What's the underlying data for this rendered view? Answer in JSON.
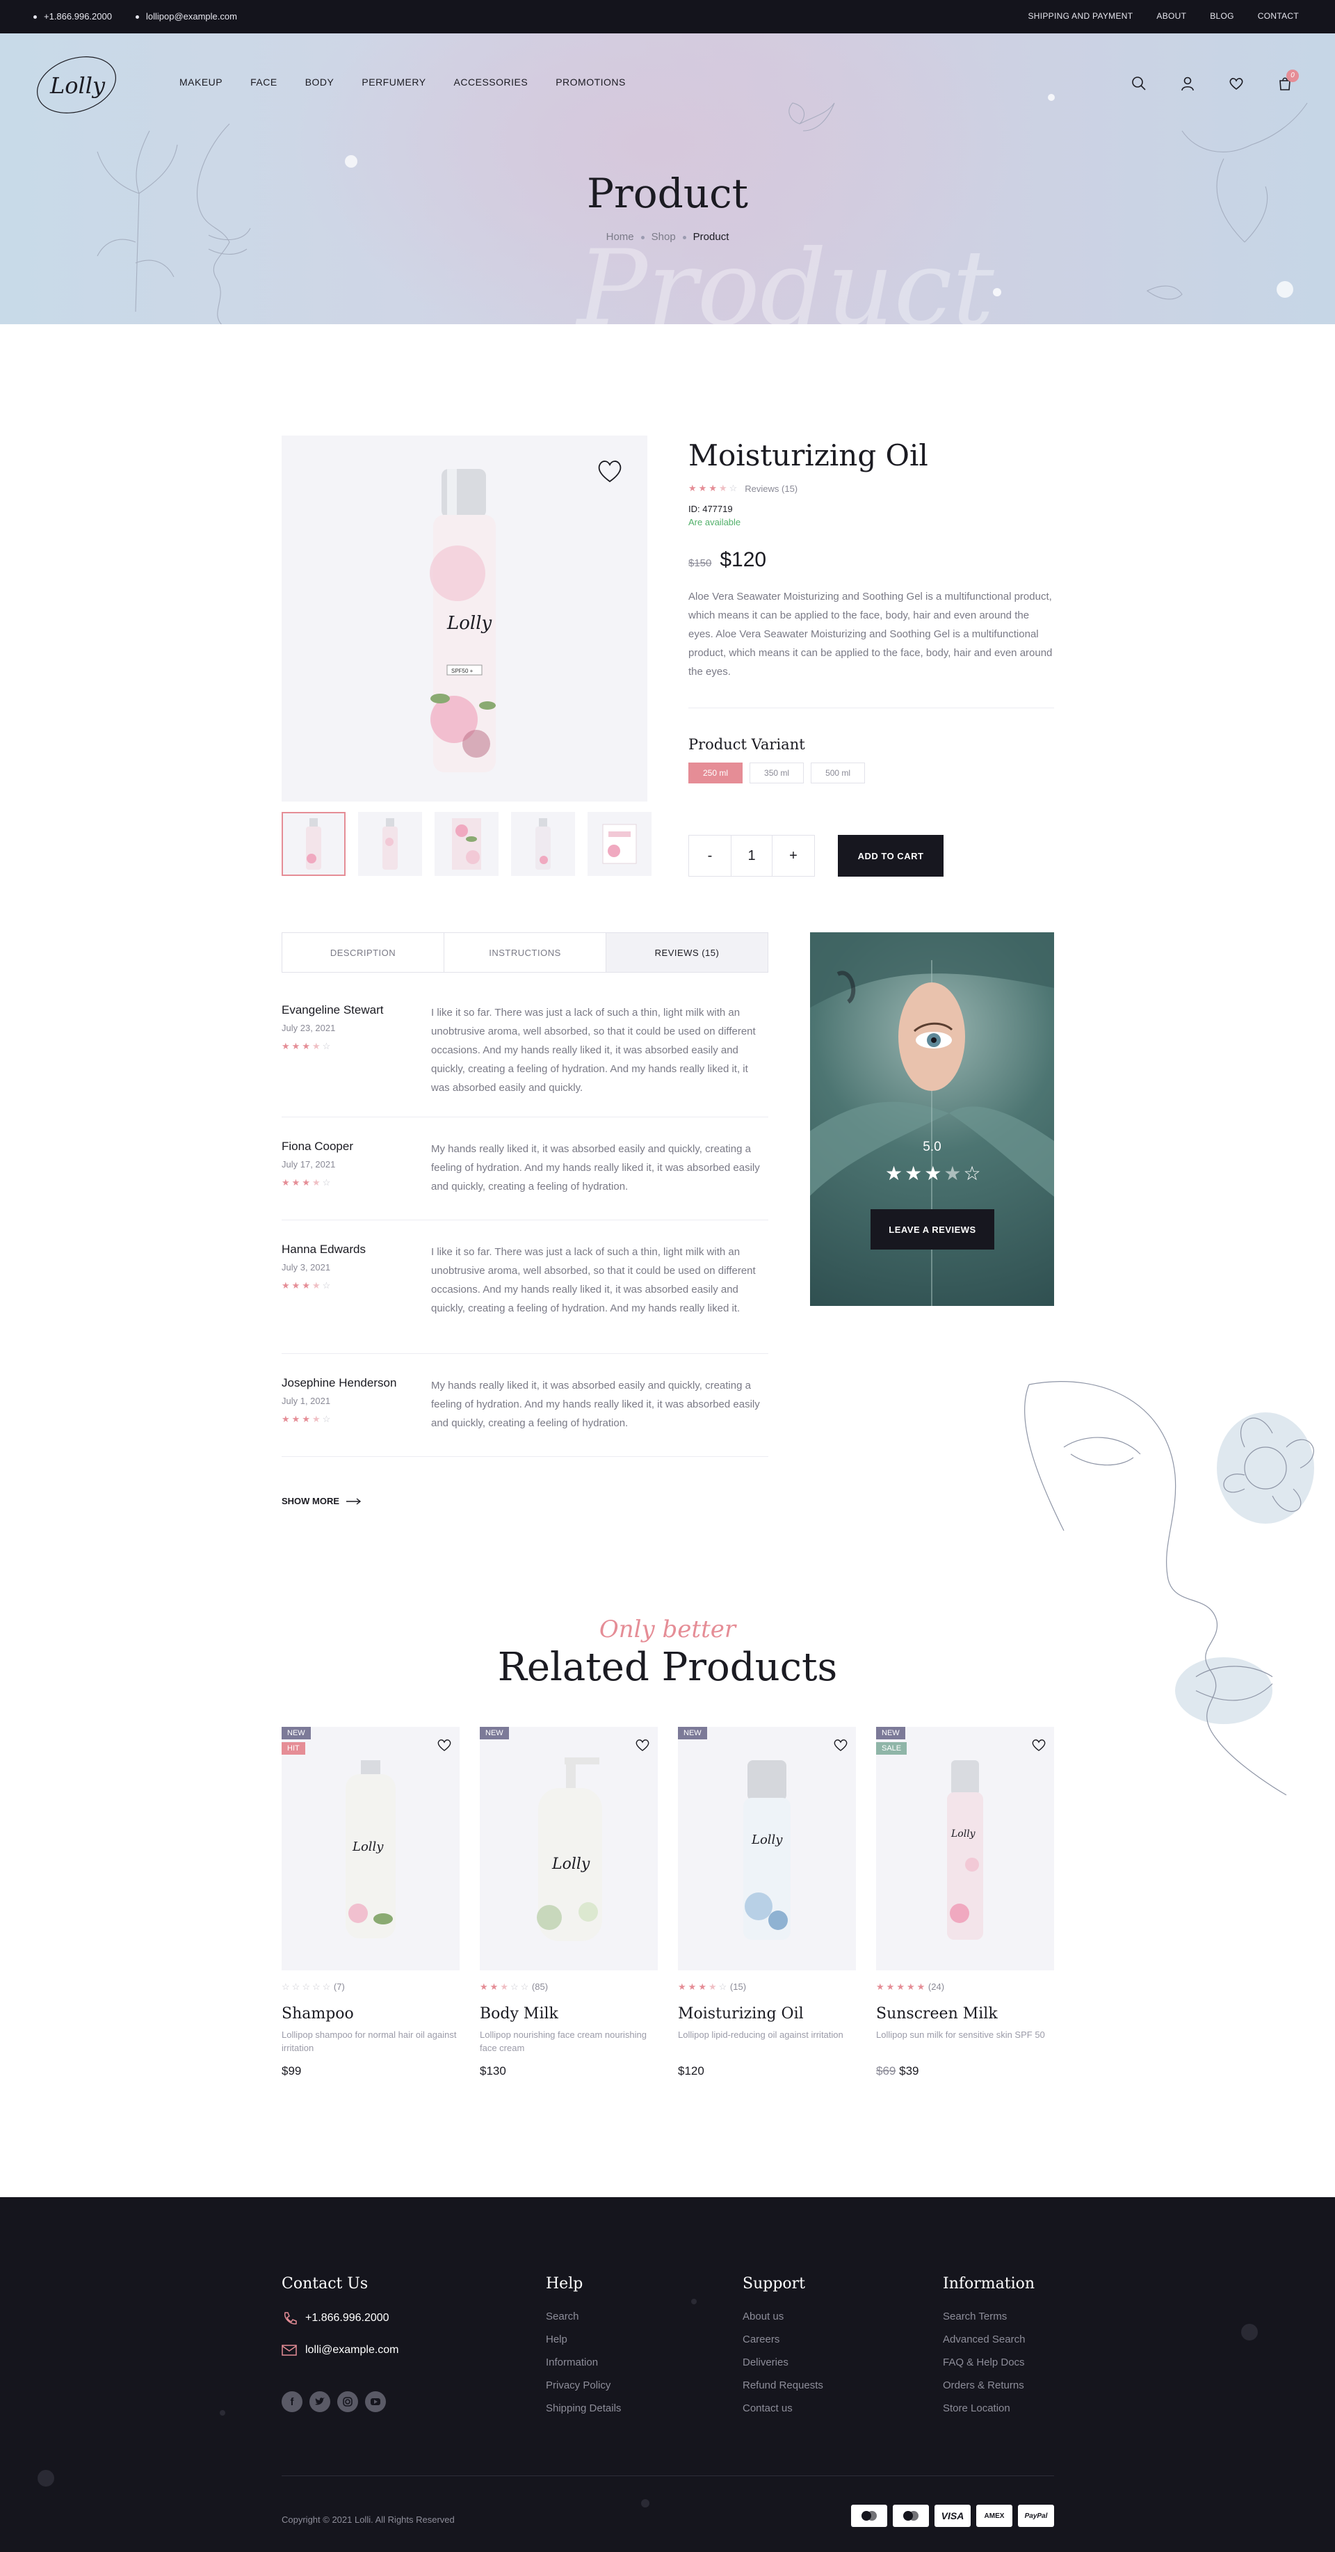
{
  "topbar": {
    "phone": "+1.866.996.2000",
    "email": "lollipop@example.com",
    "links": [
      "SHIPPING AND PAYMENT",
      "ABOUT",
      "BLOG",
      "CONTACT"
    ]
  },
  "header": {
    "logo": "Lolly",
    "nav": [
      "MAKEUP",
      "FACE",
      "BODY",
      "PERFUMERY",
      "ACCESSORIES",
      "PROMOTIONS"
    ],
    "cart_count": "0"
  },
  "hero": {
    "title": "Product",
    "watermark": "Product",
    "breadcrumb": {
      "home": "Home",
      "shop": "Shop",
      "current": "Product"
    }
  },
  "product": {
    "name": "Moisturizing Oil",
    "rating": 3.5,
    "reviews_label": "Reviews (15)",
    "id_label": "ID: 477719",
    "availability": "Are available",
    "old_price": "$150",
    "price": "$120",
    "description": "Aloe Vera Seawater Moisturizing and Soothing Gel is a multifunctional product, which means it can be applied to the face, body, hair and even around the eyes. Aloe Vera Seawater Moisturizing and Soothing Gel is a multifunctional product, which means it can be applied to the face, body, hair and even around the eyes.",
    "variant_title": "Product Variant",
    "variants": [
      "250 ml",
      "350 ml",
      "500 ml"
    ],
    "quantity": "1",
    "minus": "-",
    "plus": "+",
    "add_to_cart": "ADD TO CART",
    "bottle_label": "Lolly",
    "bottle_badge": "SPF50 +"
  },
  "tabs": [
    "DESCRIPTION",
    "INSTRUCTIONS",
    "REVIEWS (15)"
  ],
  "reviews": [
    {
      "name": "Evangeline Stewart",
      "date": "July 23, 2021",
      "rating": 3.5,
      "text": "I like it so far. There was just a lack of such a thin, light milk with an unobtrusive aroma, well absorbed, so that it could be used on different occasions. And my hands really liked it, it was absorbed easily and quickly, creating a feeling of hydration. And my hands really liked it, it was absorbed easily and quickly."
    },
    {
      "name": "Fiona Cooper",
      "date": "July 17, 2021",
      "rating": 3.5,
      "text": "My hands really liked it, it was absorbed easily and quickly, creating a feeling of hydration. And my hands really liked it, it was absorbed easily and quickly, creating a feeling of hydration."
    },
    {
      "name": "Hanna Edwards",
      "date": "July 3, 2021",
      "rating": 3.5,
      "text": "I like it so far. There was just a lack of such a thin, light milk with an unobtrusive aroma, well absorbed, so that it could be used on different occasions. And my hands really liked it, it was absorbed easily and quickly, creating a feeling of hydration. And my hands really liked it."
    },
    {
      "name": " Josephine Henderson",
      "date": "July 1, 2021",
      "rating": 3.5,
      "text": "My hands really liked it, it was absorbed easily and quickly, creating a feeling of hydration. And my hands really liked it, it was absorbed easily and quickly, creating a feeling of hydration."
    }
  ],
  "show_more": "SHOW MORE",
  "promo": {
    "score": "5.0",
    "rating": 3.5,
    "button": "LEAVE A REVIEWS"
  },
  "related": {
    "script_title": "Only better",
    "title": "Related Products",
    "items": [
      {
        "name": "Shampoo",
        "desc": "Lollipop shampoo for normal hair oil against irritation",
        "price": "$99",
        "old_price": "",
        "reviews": "(7)",
        "rating": 0,
        "badges": [
          "NEW",
          "HIT"
        ],
        "bottle": "Lolly"
      },
      {
        "name": "Body Milk",
        "desc": "Lollipop nourishing face cream nourishing face cream",
        "price": "$130",
        "old_price": "",
        "reviews": "(85)",
        "rating": 2.5,
        "badges": [
          "NEW"
        ],
        "bottle": "Lolly"
      },
      {
        "name": "Moisturizing Oil",
        "desc": "Lollipop lipid-reducing oil against irritation",
        "price": "$120",
        "old_price": "",
        "reviews": "(15)",
        "rating": 3.5,
        "badges": [
          "NEW"
        ],
        "bottle": "Lolly"
      },
      {
        "name": "Sunscreen Milk",
        "desc": "Lollipop sun milk for sensitive skin SPF 50",
        "price": "$39",
        "old_price": "$69",
        "reviews": "(24)",
        "rating": 5,
        "badges": [
          "NEW",
          "SALE"
        ],
        "bottle": "Lolly"
      }
    ]
  },
  "footer": {
    "contact_title": "Contact Us",
    "phone": "+1.866.996.2000",
    "email": "lolli@example.com",
    "help_title": "Help",
    "help": [
      "Search",
      "Help",
      "Information",
      "Privacy Policy",
      "Shipping Details"
    ],
    "support_title": "Support",
    "support": [
      "About us",
      "Careers",
      "Deliveries",
      "Refund Requests",
      "Contact us"
    ],
    "info_title": "Information",
    "info": [
      "Search Terms",
      "Advanced Search",
      "FAQ & Help Docs",
      "Orders & Returns",
      "Store Location"
    ],
    "copyright": "Copyright © 2021 Lolli.  All Rights Reserved",
    "payments": [
      "Mastercard",
      "Mastercard",
      "VISA",
      "AMEX",
      "PayPal"
    ]
  },
  "colors": {
    "accent": "#e58d96",
    "dark": "#15151d",
    "badge_new": "#7c7a98",
    "badge_hit": "#e58d96",
    "badge_sale": "#8fb5a8",
    "available": "#52b06a"
  }
}
